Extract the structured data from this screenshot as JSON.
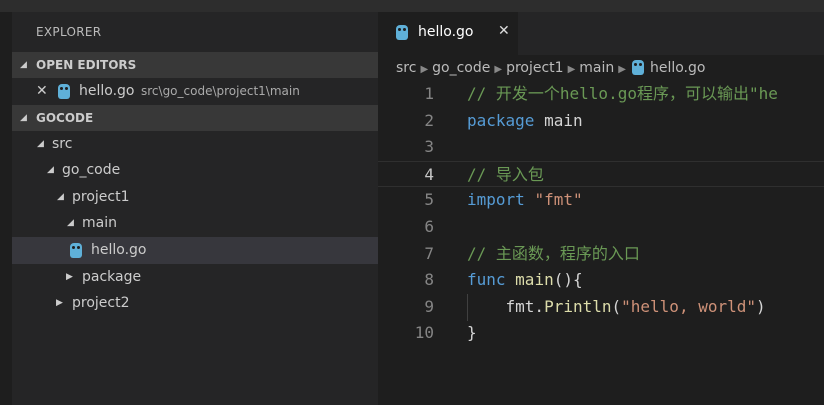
{
  "sidebar": {
    "title": "EXPLORER",
    "open_editors": {
      "label": "OPEN EDITORS",
      "items": [
        {
          "close": "✕",
          "name": "hello.go",
          "path": "src\\go_code\\project1\\main"
        }
      ]
    },
    "workspace": {
      "label": "GOCODE",
      "tree": [
        "src",
        "go_code",
        "project1",
        "main",
        "hello.go",
        "package",
        "project2"
      ]
    }
  },
  "editor": {
    "tab": {
      "name": "hello.go",
      "close": "✕"
    },
    "breadcrumb": [
      "src",
      "go_code",
      "project1",
      "main",
      "hello.go"
    ],
    "current_line": 4,
    "lines": [
      {
        "n": "1",
        "tokens": [
          {
            "t": "// 开发一个hello.go程序，可以输出\"he",
            "c": "cmt"
          }
        ]
      },
      {
        "n": "2",
        "tokens": [
          {
            "t": "package",
            "c": "kw"
          },
          {
            "t": " main",
            "c": "id"
          }
        ]
      },
      {
        "n": "3",
        "tokens": []
      },
      {
        "n": "4",
        "tokens": [
          {
            "t": "// 导入包",
            "c": "cmt"
          }
        ]
      },
      {
        "n": "5",
        "tokens": [
          {
            "t": "import",
            "c": "kw"
          },
          {
            "t": " ",
            "c": "id"
          },
          {
            "t": "\"fmt\"",
            "c": "str"
          }
        ]
      },
      {
        "n": "6",
        "tokens": []
      },
      {
        "n": "7",
        "tokens": [
          {
            "t": "// 主函数，程序的入口",
            "c": "cmt"
          }
        ]
      },
      {
        "n": "8",
        "tokens": [
          {
            "t": "func",
            "c": "kw"
          },
          {
            "t": " ",
            "c": "id"
          },
          {
            "t": "main",
            "c": "fn"
          },
          {
            "t": "(){",
            "c": "id"
          }
        ]
      },
      {
        "n": "9",
        "tokens": [
          {
            "t": "    fmt.",
            "c": "id"
          },
          {
            "t": "Println",
            "c": "fn"
          },
          {
            "t": "(",
            "c": "id"
          },
          {
            "t": "\"hello, world\"",
            "c": "str"
          },
          {
            "t": ")",
            "c": "id"
          }
        ]
      },
      {
        "n": "10",
        "tokens": [
          {
            "t": "}",
            "c": "id"
          }
        ]
      }
    ]
  },
  "colors": {
    "comment": "#6a9955",
    "keyword": "#569cd6",
    "string": "#ce9178",
    "function": "#dcdcaa",
    "go_icon": "#5fb0d8"
  }
}
